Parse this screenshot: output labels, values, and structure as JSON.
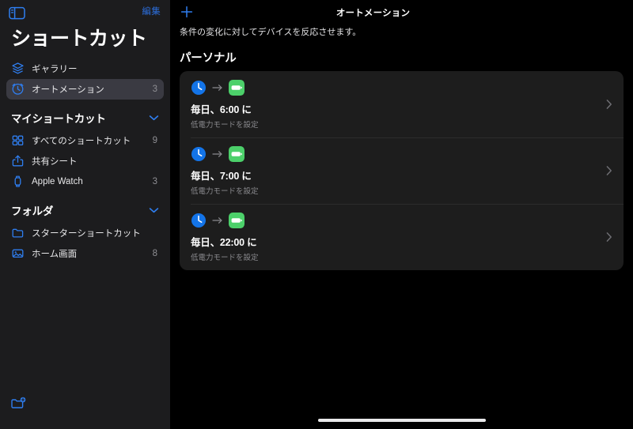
{
  "sidebar": {
    "toggle_icon": "sidebar-toggle-icon",
    "edit_label": "編集",
    "app_title": "ショートカット",
    "top_items": [
      {
        "icon": "layers-icon",
        "label": "ギャラリー",
        "count": "",
        "selected": false
      },
      {
        "icon": "clock-circle-icon",
        "label": "オートメーション",
        "count": "3",
        "selected": true
      }
    ],
    "sections": [
      {
        "header": "マイショートカット",
        "chevron": "chevron-down-icon",
        "items": [
          {
            "icon": "grid-icon",
            "label": "すべてのショートカット",
            "count": "9"
          },
          {
            "icon": "share-icon",
            "label": "共有シート",
            "count": ""
          },
          {
            "icon": "apple-watch-icon",
            "label": "Apple Watch",
            "count": "3"
          }
        ]
      },
      {
        "header": "フォルダ",
        "chevron": "chevron-down-icon",
        "items": [
          {
            "icon": "folder-icon",
            "label": "スターターショートカット",
            "count": ""
          },
          {
            "icon": "photo-icon",
            "label": "ホーム画面",
            "count": "8"
          }
        ]
      }
    ],
    "new_folder_icon": "new-folder-icon"
  },
  "main": {
    "add_icon": "plus-icon",
    "nav_title": "オートメーション",
    "subtitle": "条件の変化に対してデバイスを反応させます。",
    "section_title": "パーソナル",
    "automations": [
      {
        "trigger_icon": "clock-icon",
        "arrow_icon": "arrow-right-icon",
        "action_icon": "battery-icon",
        "title": "毎日、6:00 に",
        "subtitle": "低電力モードを設定",
        "chevron": "chevron-right-icon"
      },
      {
        "trigger_icon": "clock-icon",
        "arrow_icon": "arrow-right-icon",
        "action_icon": "battery-icon",
        "title": "毎日、7:00 に",
        "subtitle": "低電力モードを設定",
        "chevron": "chevron-right-icon"
      },
      {
        "trigger_icon": "clock-icon",
        "arrow_icon": "arrow-right-icon",
        "action_icon": "battery-icon",
        "title": "毎日、22:00 に",
        "subtitle": "低電力モードを設定",
        "chevron": "chevron-right-icon"
      }
    ]
  },
  "colors": {
    "accent_blue": "#2b6bd6",
    "icon_blue": "#2f7ef0",
    "action_green": "#4cd06a",
    "sidebar_bg": "#1c1c1e",
    "main_bg": "#000000",
    "card_bg": "#1d1d1d",
    "selected_row_bg": "#3a3a42",
    "secondary_text": "#8e8e93"
  },
  "home_indicator": true
}
